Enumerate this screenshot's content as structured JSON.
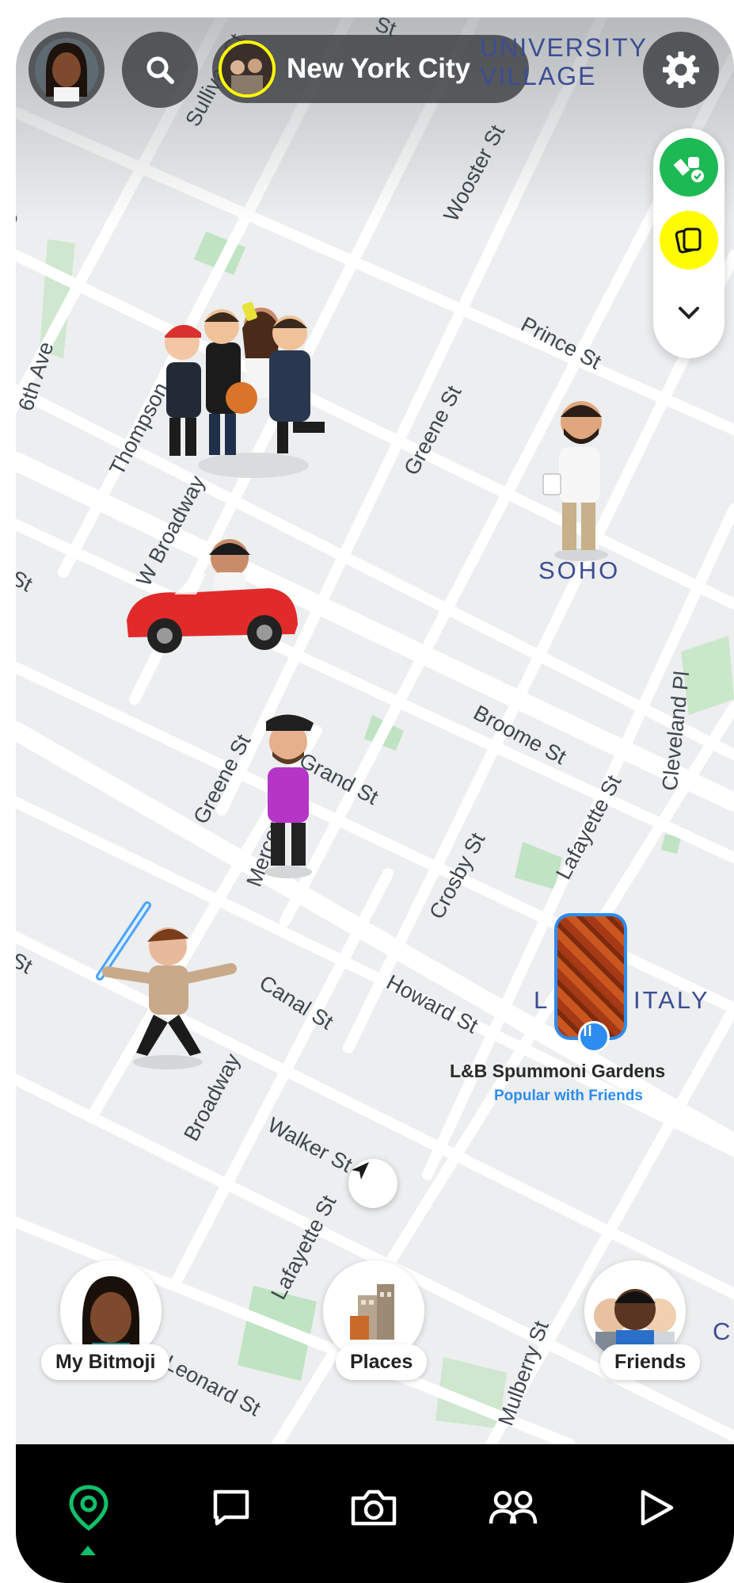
{
  "header": {
    "location_title": "New York City",
    "neighborhood_top": "UNIVERSITY VILLAGE"
  },
  "streets": {
    "s1": "Sullivan St",
    "s2": "Wooster St",
    "s3": "Prince St",
    "s4": "6th Ave",
    "s5": "6th Ave",
    "s6": "Thompson",
    "s7": "Greene St",
    "s8": "W Broadway",
    "s9": "Broome St",
    "s10": "Greene St",
    "s11": "Grand St",
    "s12": "Mercer St",
    "s13": "Crosby St",
    "s14": "Lafayette St",
    "s15": "Cleveland Pl",
    "s16": "Canal St",
    "s17": "Howard St",
    "s18": "Broadway",
    "s19": "Walker St",
    "s20": "Lafayette St",
    "s21": "Leonard St",
    "s22": "Mulberry St",
    "s23": "St",
    "s24": "St",
    "s25": "St"
  },
  "neighborhoods": {
    "soho": "SOHO",
    "little_italy_l": "L",
    "little_italy_rest": "ITALY",
    "c": "C"
  },
  "place_card": {
    "name": "L&B Spummoni Gardens",
    "subtitle": "Popular with Friends"
  },
  "fabs": {
    "my_bitmoji": "My Bitmoji",
    "places": "Places",
    "friends": "Friends"
  },
  "colors": {
    "accent_green": "#1db954",
    "snap_yellow": "#fffc00",
    "place_blue": "#2d8cf0",
    "nav_active": "#12c06a"
  },
  "nav": {
    "items": [
      "map-icon",
      "chat-icon",
      "camera-icon",
      "friends-icon",
      "stories-icon"
    ],
    "active": "map-icon"
  }
}
